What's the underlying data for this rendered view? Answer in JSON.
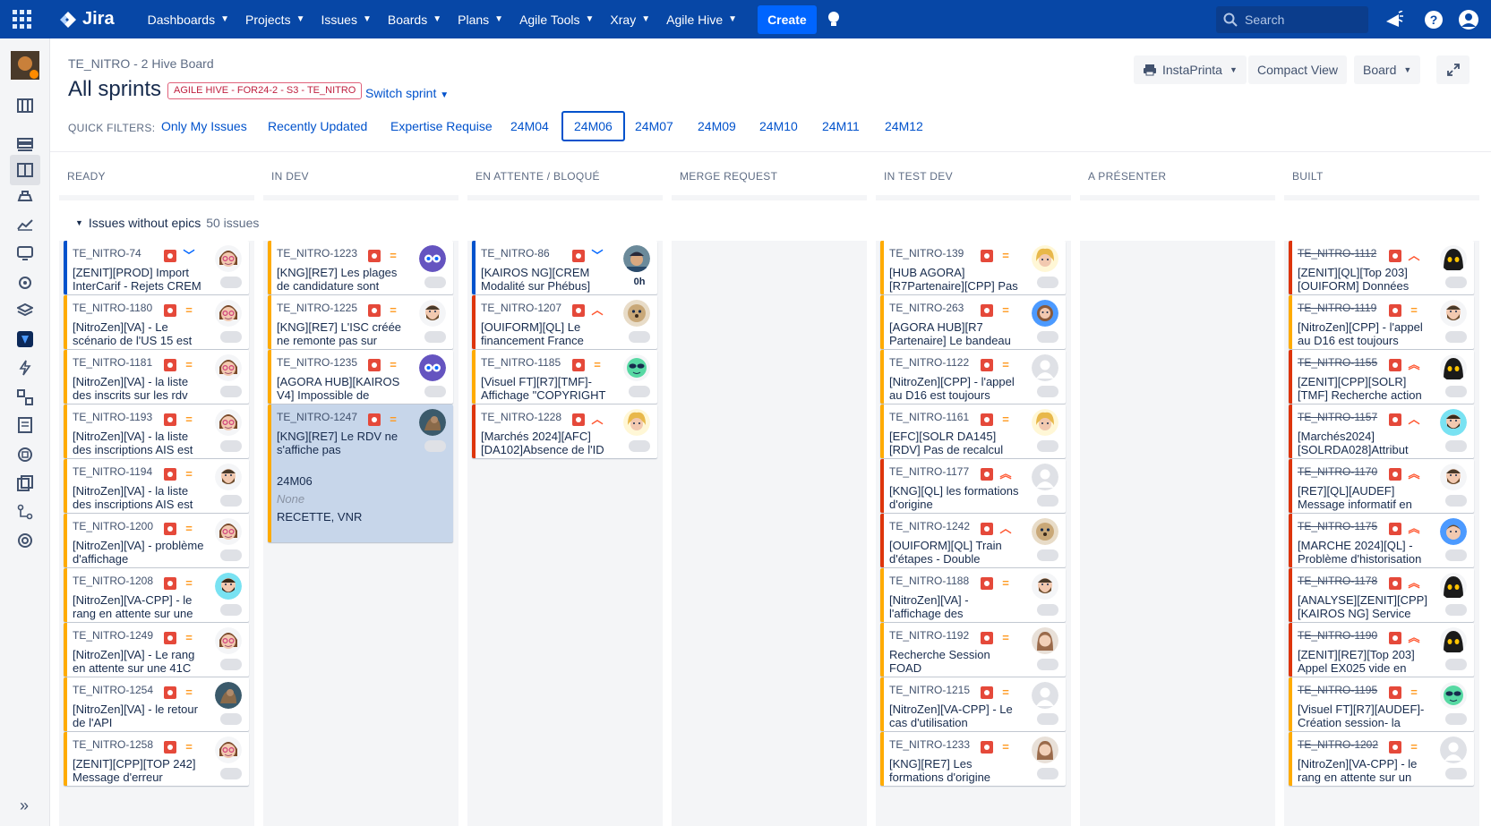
{
  "nav": {
    "logo": "Jira",
    "menu": [
      "Dashboards",
      "Projects",
      "Issues",
      "Boards",
      "Plans",
      "Agile Tools",
      "Xray",
      "Agile Hive"
    ],
    "create": "Create",
    "search_placeholder": "Search"
  },
  "header": {
    "breadcrumb": "TE_NITRO - 2 Hive Board",
    "title": "All sprints",
    "sprint_badge": "AGILE HIVE - FOR24-2 - S3 - TE_NITRO",
    "switch_sprint": "Switch sprint",
    "instaprinta": "InstaPrinta",
    "compact_view": "Compact View",
    "board": "Board"
  },
  "quick_filters": {
    "label": "QUICK FILTERS:",
    "items": [
      "Only My Issues",
      "Recently Updated",
      "Expertise Requise",
      "24M04",
      "24M06",
      "24M07",
      "24M09",
      "24M10",
      "24M11",
      "24M12"
    ],
    "selected": "24M06"
  },
  "columns": [
    "READY",
    "IN DEV",
    "EN ATTENTE / BLOQUÉ",
    "MERGE REQUEST",
    "IN TEST DEV",
    "A PRÉSENTER",
    "BUILT"
  ],
  "swimlane": {
    "label": "Issues without epics",
    "count": "50 issues"
  },
  "cards": {
    "ready": [
      {
        "key": "TE_NITRO-74",
        "summary": "[ZENIT][PROD] Import InterCarif - Rejets CREM",
        "priority": "low",
        "border": "blue",
        "avatar": "woman-glasses"
      },
      {
        "key": "TE_NITRO-1180",
        "summary": "[NitroZen][VA] - Le scénario de l'US 15 est",
        "priority": "med",
        "border": "yellow",
        "avatar": "woman-glasses"
      },
      {
        "key": "TE_NITRO-1181",
        "summary": "[NitroZen][VA] - la liste des inscrits sur les rdv",
        "priority": "med",
        "border": "yellow",
        "avatar": "woman-glasses"
      },
      {
        "key": "TE_NITRO-1193",
        "summary": "[NitroZen][VA] - la liste des inscriptions AIS est",
        "priority": "med",
        "border": "yellow",
        "avatar": "woman-glasses"
      },
      {
        "key": "TE_NITRO-1194",
        "summary": "[NitroZen][VA] - la liste des inscriptions AIS est",
        "priority": "med",
        "border": "yellow",
        "avatar": "man-beard"
      },
      {
        "key": "TE_NITRO-1200",
        "summary": "[NitroZen][VA] - problème d'affichage",
        "priority": "med",
        "border": "yellow",
        "avatar": "woman-glasses"
      },
      {
        "key": "TE_NITRO-1208",
        "summary": "[NitroZen][VA-CPP] - le rang en attente sur une",
        "priority": "med",
        "border": "yellow",
        "avatar": "man-teal"
      },
      {
        "key": "TE_NITRO-1249",
        "summary": "[NitroZen][VA] - Le rang en attente sur une 41C",
        "priority": "med",
        "border": "yellow",
        "avatar": "woman-glasses"
      },
      {
        "key": "TE_NITRO-1254",
        "summary": "[NitroZen][VA] - le retour de l'API",
        "priority": "med",
        "border": "yellow",
        "avatar": "photo"
      },
      {
        "key": "TE_NITRO-1258",
        "summary": "[ZENIT][CPP][TOP 242] Message d'erreur",
        "priority": "med",
        "border": "yellow",
        "avatar": "woman-glasses"
      }
    ],
    "indev": [
      {
        "key": "TE_NITRO-1223",
        "summary": "[KNG][RE7] Les plages de candidature sont",
        "priority": "med",
        "border": "yellow",
        "avatar": "owl"
      },
      {
        "key": "TE_NITRO-1225",
        "summary": "[KNG][RE7] L'ISC créée ne remonte pas sur",
        "priority": "med",
        "border": "yellow",
        "avatar": "man-beard"
      },
      {
        "key": "TE_NITRO-1235",
        "summary": "[AGORA HUB][KAIROS V4] Impossible de",
        "priority": "med",
        "border": "yellow",
        "avatar": "owl"
      },
      {
        "key": "TE_NITRO-1247",
        "summary": "[KNG][RE7] Le RDV ne s'affiche pas",
        "priority": "med",
        "border": "yellow",
        "avatar": "photo",
        "extra": [
          "24M06",
          "None",
          "RECETTE, VNR"
        ]
      }
    ],
    "blocked": [
      {
        "key": "TE_NITRO-86",
        "summary": "[KAIROS NG][CREM Modalité sur Phébus]",
        "priority": "low",
        "border": "blue",
        "avatar": "photo-cap",
        "estimate": "0h"
      },
      {
        "key": "TE_NITRO-1207",
        "summary": "[OUIFORM][QL] Le financement France",
        "priority": "high",
        "border": "red",
        "avatar": "dog"
      },
      {
        "key": "TE_NITRO-1185",
        "summary": "[Visuel FT][R7][TMF]-Affichage \"COPYRIGHT",
        "priority": "med",
        "border": "yellow",
        "avatar": "alien"
      },
      {
        "key": "TE_NITRO-1228",
        "summary": "[Marchés 2024][AFC][DA102]Absence de l'ID",
        "priority": "high",
        "border": "red",
        "avatar": "woman-blonde"
      }
    ],
    "intest": [
      {
        "key": "TE_NITRO-139",
        "summary": "[HUB AGORA][R7Partenaire][CPP] Pas",
        "priority": "med",
        "border": "yellow",
        "avatar": "woman-blonde"
      },
      {
        "key": "TE_NITRO-263",
        "summary": "[AGORA HUB][R7 Partenaire] Le bandeau",
        "priority": "med",
        "border": "yellow",
        "avatar": "man-brown"
      },
      {
        "key": "TE_NITRO-1122",
        "summary": "[NitroZen][CPP] - l'appel au D16 est toujours",
        "priority": "med",
        "border": "yellow",
        "avatar": "default"
      },
      {
        "key": "TE_NITRO-1161",
        "summary": "[EFC][SOLR DA145][RDV] Pas de recalcul",
        "priority": "med",
        "border": "yellow",
        "avatar": "woman-blonde"
      },
      {
        "key": "TE_NITRO-1177",
        "summary": "[KNG][QL] les formations d'origine",
        "priority": "highest",
        "border": "red",
        "avatar": "default"
      },
      {
        "key": "TE_NITRO-1242",
        "summary": "[OUIFORM][QL] Train d'étapes - Double",
        "priority": "high",
        "border": "red",
        "avatar": "dog"
      },
      {
        "key": "TE_NITRO-1188",
        "summary": "[NitroZen][VA] - l'affichage des",
        "priority": "med",
        "border": "yellow",
        "avatar": "man-beard"
      },
      {
        "key": "TE_NITRO-1192",
        "summary": "Recherche Session FOAD",
        "priority": "med",
        "border": "yellow",
        "avatar": "woman-photo"
      },
      {
        "key": "TE_NITRO-1215",
        "summary": "[NitroZen][VA-CPP] - Le cas d'utilisation",
        "priority": "med",
        "border": "yellow",
        "avatar": "default"
      },
      {
        "key": "TE_NITRO-1233",
        "summary": "[KNG][RE7] Les formations d'origine",
        "priority": "med",
        "border": "yellow",
        "avatar": "woman-photo"
      }
    ],
    "built": [
      {
        "key": "TE_NITRO-1112",
        "summary": "[ZENIT][QL][Top 203] [OUIFORM] Données",
        "priority": "high",
        "border": "red",
        "avatar": "black"
      },
      {
        "key": "TE_NITRO-1119",
        "summary": "[NitroZen][CPP] - l'appel au D16 est toujours",
        "priority": "med",
        "border": "yellow",
        "avatar": "man-beard"
      },
      {
        "key": "TE_NITRO-1155",
        "summary": "[ZENIT][CPP][SOLR] [TMF] Recherche action",
        "priority": "highest",
        "border": "red",
        "avatar": "black"
      },
      {
        "key": "TE_NITRO-1157",
        "summary": "[Marchés2024] [SOLRDA028]Attribut",
        "priority": "high",
        "border": "red",
        "avatar": "man-teal"
      },
      {
        "key": "TE_NITRO-1170",
        "summary": "[RE7][QL][AUDEF] Message informatif en",
        "priority": "highest",
        "border": "red",
        "avatar": "man-beard"
      },
      {
        "key": "TE_NITRO-1175",
        "summary": "[MARCHE 2024][QL] - Problème d'historisation",
        "priority": "highest",
        "border": "red",
        "avatar": "boy-blue"
      },
      {
        "key": "TE_NITRO-1178",
        "summary": "[ANALYSE][ZENIT][CPP] [KAIROS NG] Service",
        "priority": "highest",
        "border": "red",
        "avatar": "black"
      },
      {
        "key": "TE_NITRO-1190",
        "summary": "[ZENIT][RE7][Top 203] Appel EX025 vide en",
        "priority": "highest",
        "border": "red",
        "avatar": "black"
      },
      {
        "key": "TE_NITRO-1195",
        "summary": "[Visuel FT][R7][AUDEF]-Création session- la",
        "priority": "med",
        "border": "yellow",
        "avatar": "alien"
      },
      {
        "key": "TE_NITRO-1202",
        "summary": "[NitroZen][VA-CPP] - le rang en attente sur un",
        "priority": "med",
        "border": "yellow",
        "avatar": "default"
      }
    ]
  }
}
